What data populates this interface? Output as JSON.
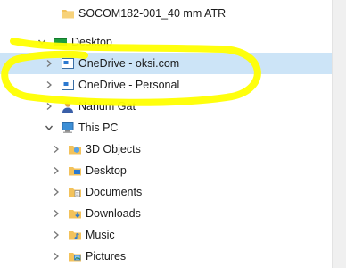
{
  "tree": {
    "items": [
      {
        "label": "SOCOM182-001_40 mm ATR",
        "icon": "folder-icon",
        "expanded": false
      },
      {
        "label": "Desktop",
        "icon": "desktop-icon",
        "expanded": true
      },
      {
        "label": "OneDrive - oksi.com",
        "icon": "onedrive-icon",
        "expanded": false,
        "selected": true
      },
      {
        "label": "OneDrive - Personal",
        "icon": "onedrive-icon",
        "expanded": false
      },
      {
        "label": "Nahum Gat",
        "icon": "user-icon",
        "expanded": false
      },
      {
        "label": "This PC",
        "icon": "computer-icon",
        "expanded": true
      },
      {
        "label": "3D Objects",
        "icon": "3d-objects-icon",
        "expanded": false
      },
      {
        "label": "Desktop",
        "icon": "desktop-folder-icon",
        "expanded": false
      },
      {
        "label": "Documents",
        "icon": "documents-icon",
        "expanded": false
      },
      {
        "label": "Downloads",
        "icon": "downloads-icon",
        "expanded": false
      },
      {
        "label": "Music",
        "icon": "music-icon",
        "expanded": false
      },
      {
        "label": "Pictures",
        "icon": "pictures-icon",
        "expanded": false
      }
    ]
  },
  "colors": {
    "selection": "#cce4f7",
    "highlighter": "#ffff00",
    "folder": "#f3c25b"
  }
}
